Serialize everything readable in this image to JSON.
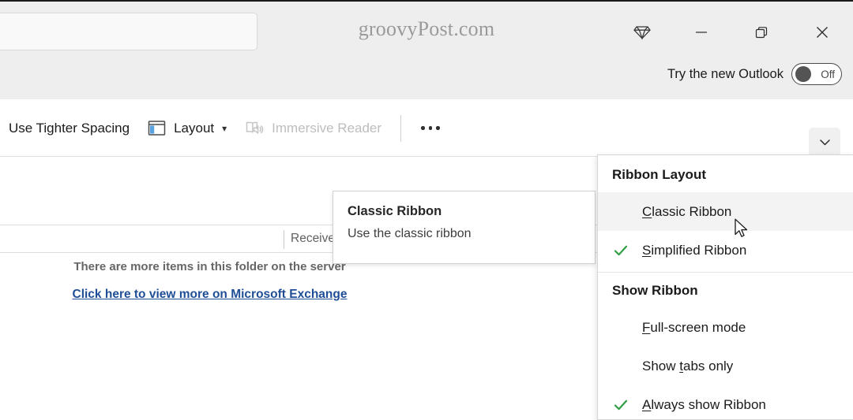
{
  "window": {
    "watermark": "groovyPost.com",
    "search_placeholder": "",
    "search_value": "",
    "caption_buttons": [
      {
        "name": "diamond-icon",
        "label": "Microsoft 365 Premium"
      },
      {
        "name": "minimize-button",
        "label": "Minimize"
      },
      {
        "name": "restore-button",
        "label": "Restore Down"
      },
      {
        "name": "close-button",
        "label": "Close"
      }
    ],
    "try_new_outlook": {
      "label": "Try the new Outlook",
      "toggle_state": "Off"
    }
  },
  "ribbon": {
    "items": [
      {
        "label": "Use Tighter Spacing",
        "icon": "",
        "disabled": false,
        "has_chevron": false
      },
      {
        "label": "Layout",
        "icon": "layout-icon",
        "disabled": false,
        "has_chevron": true
      },
      {
        "label": "Immersive Reader",
        "icon": "immersive-reader-icon",
        "disabled": true,
        "has_chevron": false
      }
    ],
    "overflow_label": "More options",
    "collapse_label": "Collapse the Ribbon"
  },
  "message_list": {
    "column_header_received": "Received",
    "more_items_text": "There are more items in this folder on the server",
    "exchange_link_text": "Click here to view more on Microsoft Exchange"
  },
  "tooltip": {
    "title": "Classic Ribbon",
    "body": "Use the classic ribbon"
  },
  "menu": {
    "sections": [
      {
        "header": "Ribbon Layout",
        "items": [
          {
            "label": "Classic Ribbon",
            "accel": "C",
            "checked": false,
            "hovered": true
          },
          {
            "label": "Simplified Ribbon",
            "accel": "S",
            "checked": true,
            "hovered": false
          }
        ]
      },
      {
        "header": "Show Ribbon",
        "items": [
          {
            "label": "Full-screen mode",
            "accel": "F",
            "checked": false,
            "hovered": false
          },
          {
            "label": "Show tabs only",
            "accel": "t",
            "checked": false,
            "hovered": false
          },
          {
            "label": "Always show Ribbon",
            "accel": "A",
            "checked": true,
            "hovered": false
          }
        ]
      }
    ]
  },
  "colors": {
    "chrome_bg": "#eeeeee",
    "check_green": "#2f9e44",
    "link_blue": "#1f4e96",
    "accent_blue": "#5aa2e0",
    "hover_gray": "#f3f3f3"
  }
}
